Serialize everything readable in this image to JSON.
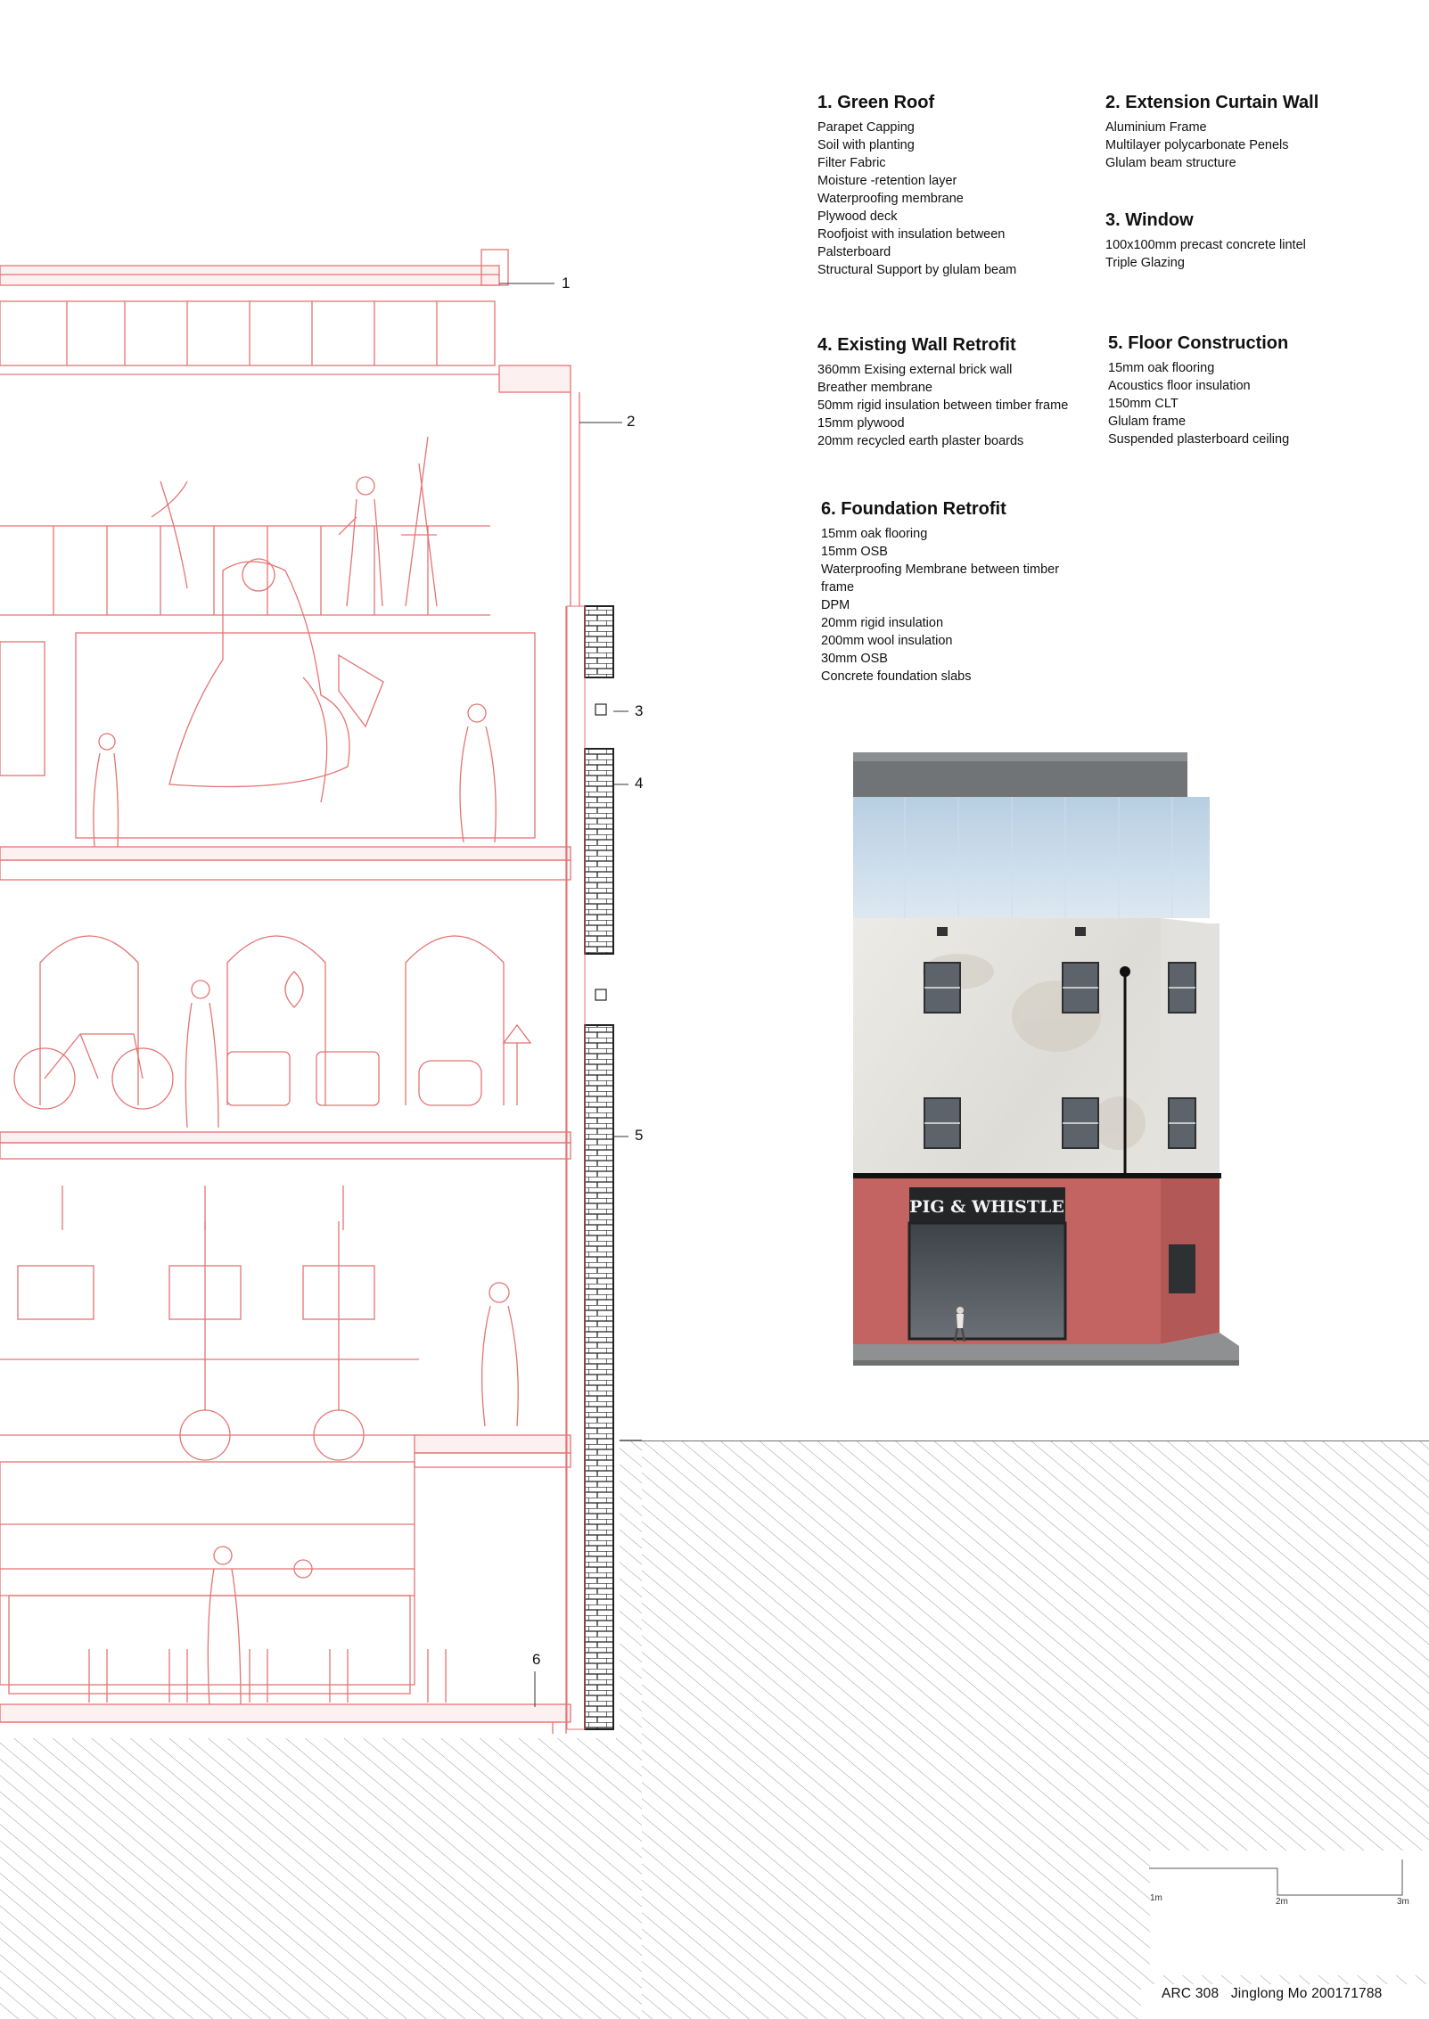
{
  "specs": [
    {
      "title": "1. Green Roof",
      "items": [
        "Parapet Capping",
        "Soil with planting",
        "Filter Fabric",
        "Moisture -retention layer",
        "Waterproofing membrane",
        "Plywood deck",
        "Roofjoist with insulation between",
        "Palsterboard",
        "Structural Support by glulam beam"
      ]
    },
    {
      "title": "2. Extension Curtain Wall",
      "items": [
        "Aluminium  Frame",
        "Multilayer polycarbonate Penels",
        "Glulam beam structure"
      ]
    },
    {
      "title": "3. Window",
      "items": [
        "100x100mm precast concrete lintel",
        "Triple Glazing"
      ]
    },
    {
      "title": "4. Existing Wall Retrofit",
      "items": [
        "360mm Exising external brick wall",
        "Breather membrane",
        "50mm rigid insulation between timber frame",
        "15mm plywood",
        "20mm recycled earth plaster boards"
      ]
    },
    {
      "title": "5. Floor Construction",
      "items": [
        "15mm oak flooring",
        "Acoustics floor insulation",
        "150mm CLT",
        "Glulam frame",
        "Suspended plasterboard ceiling"
      ]
    },
    {
      "title": "6. Foundation Retrofit",
      "items": [
        "15mm oak flooring",
        "15mm OSB",
        "Waterproofing Membrane between timber",
        "frame",
        "DPM",
        "20mm rigid insulation",
        "200mm wool insulation",
        "30mm OSB",
        "Concrete foundation slabs"
      ]
    }
  ],
  "callouts": [
    "1",
    "2",
    "3",
    "4",
    "5",
    "6"
  ],
  "shop_sign": "PIG & WHISTLE",
  "scale_bar": {
    "labels": [
      "1m",
      "2m",
      "3m"
    ]
  },
  "footer": {
    "course": "ARC 308",
    "author": "Jinglong Mo 200171788"
  },
  "colors": {
    "section_line": "#e57373",
    "brick": "#222222",
    "shopfront": "#c46462",
    "render": "#e8e6e2",
    "curtain_wall": "#c9dceb"
  }
}
